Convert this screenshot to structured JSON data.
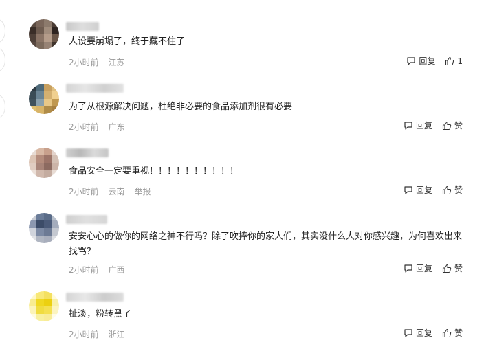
{
  "comments": [
    {
      "text": "人设要崩塌了，终于藏不住了",
      "time": "2小时前",
      "location": "江苏",
      "reply_label": "回复",
      "like_label": "1",
      "avatar_colors": [
        "#5a4a40",
        "#7a665a",
        "#8c7a6c",
        "#4a3c34",
        "#3a2e28",
        "#6e5c50",
        "#a08c7c",
        "#2e2420",
        "#4e4038",
        "#8a7466",
        "#b49c8a",
        "#6a5648",
        "#584840",
        "#7c6a5c",
        "#968274",
        "#40342c"
      ]
    },
    {
      "text": "为了从根源解决问题，杜绝非必要的食品添加剂很有必要",
      "time": "2小时前",
      "location": "广东",
      "reply_label": "回复",
      "like_label": "赞",
      "avatar_colors": [
        "#2e3a42",
        "#4e6a7a",
        "#c8a060",
        "#e0c080",
        "#3a4c56",
        "#6a8494",
        "#d4b070",
        "#f0d090",
        "#40525c",
        "#8aa0ac",
        "#e8c888",
        "#c09850",
        "#e0c070",
        "#d8b468",
        "#b08c48",
        "#a88040"
      ]
    },
    {
      "text": "食品安全一定要重视！！！！！！！！！！",
      "time": "2小时前",
      "location": "云南",
      "report_label": "举报",
      "reply_label": "回复",
      "like_label": "赞",
      "avatar_colors": [
        "#e8dcd4",
        "#d8b8a4",
        "#c8a08c",
        "#e4d4cc",
        "#dcc4b4",
        "#b48c7c",
        "#9c7468",
        "#d4c0b4",
        "#e0ccc0",
        "#a88478",
        "#8c6a60",
        "#ccb4a8",
        "#ece0d8",
        "#d0b8ac",
        "#c4aca0",
        "#e8dcd4"
      ]
    },
    {
      "text": "安安心心的做你的网络之神不行吗？除了吹捧你的家人们，其实没什么人对你感兴趣，为何喜欢出来找骂？",
      "time": "2小时前",
      "location": "广西",
      "reply_label": "回复",
      "like_label": "赞",
      "avatar_colors": [
        "#c8ccd4",
        "#6a7c98",
        "#5a6c88",
        "#b8c0cc",
        "#8c98b0",
        "#3c4c68",
        "#4a5a78",
        "#a4acbc",
        "#d0d4dc",
        "#7c8aa4",
        "#6c7a94",
        "#c4c8d0",
        "#e0e2e6",
        "#b0b6c2",
        "#a8aebc",
        "#dcdee2"
      ]
    },
    {
      "text": "扯淡，粉转黑了",
      "time": "2小时前",
      "location": "浙江",
      "reply_label": "回复",
      "like_label": "赞",
      "avatar_colors": [
        "#fff8c8",
        "#f8e878",
        "#f4e060",
        "#fffad8",
        "#f8ec90",
        "#f0d820",
        "#ecd010",
        "#f8f0a8",
        "#fcf4b8",
        "#f0dc40",
        "#f4e050",
        "#fcf4c0",
        "#fffce0",
        "#f8f0a0",
        "#f8ec98",
        "#fffce8"
      ]
    }
  ]
}
